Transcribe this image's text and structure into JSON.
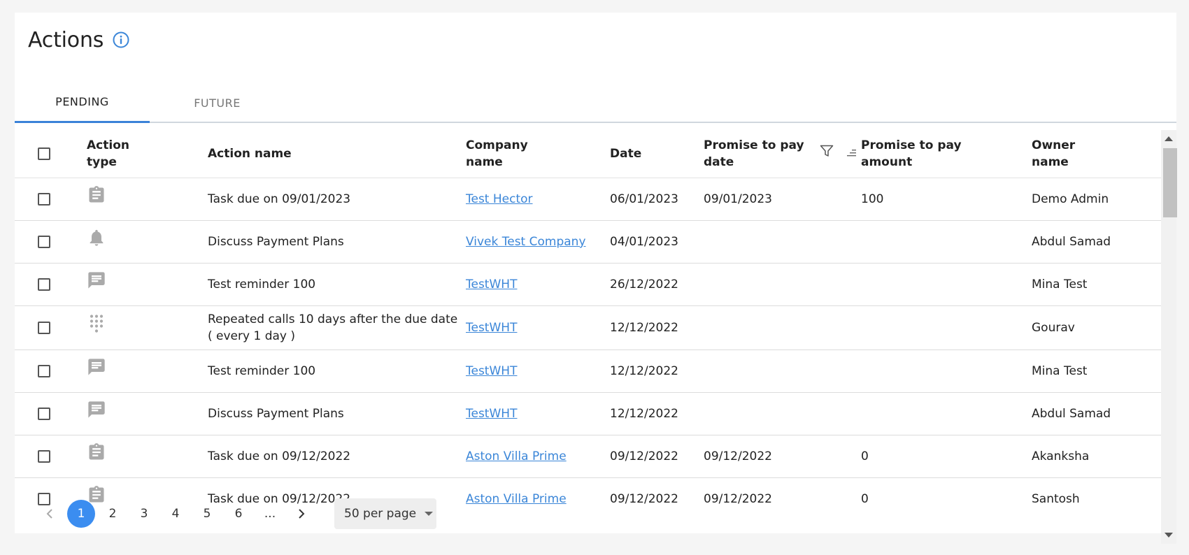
{
  "page": {
    "title": "Actions",
    "info_icon": "info-icon"
  },
  "tabs": [
    {
      "label": "PENDING",
      "active": true
    },
    {
      "label": "FUTURE",
      "active": false
    }
  ],
  "table": {
    "headers": {
      "action_type": [
        "Action",
        "type"
      ],
      "action_name": "Action name",
      "company_name": [
        "Company",
        "name"
      ],
      "date": "Date",
      "promise_date": [
        "Promise to pay",
        "date"
      ],
      "promise_amount": [
        "Promise to pay",
        "amount"
      ],
      "owner_name": [
        "Owner",
        "name"
      ]
    },
    "rows": [
      {
        "icon": "clipboard-icon",
        "action_name": "Task due on 09/01/2023",
        "company": "Test Hector",
        "date": "06/01/2023",
        "promise_date": "09/01/2023",
        "promise_amount": "100",
        "owner": "Demo Admin"
      },
      {
        "icon": "bell-icon",
        "action_name": "Discuss Payment Plans",
        "company": "Vivek Test Company",
        "date": "04/01/2023",
        "promise_date": "",
        "promise_amount": "",
        "owner": "Abdul Samad"
      },
      {
        "icon": "message-icon",
        "action_name": "Test reminder 100",
        "company": "TestWHT",
        "date": "26/12/2022",
        "promise_date": "",
        "promise_amount": "",
        "owner": "Mina Test"
      },
      {
        "icon": "dialpad-icon",
        "action_name": "Repeated calls 10 days after the due date",
        "action_name_2": "( every 1 day )",
        "company": "TestWHT",
        "date": "12/12/2022",
        "promise_date": "",
        "promise_amount": "",
        "owner": "Gourav"
      },
      {
        "icon": "message-icon",
        "action_name": "Test reminder 100",
        "company": "TestWHT",
        "date": "12/12/2022",
        "promise_date": "",
        "promise_amount": "",
        "owner": "Mina Test"
      },
      {
        "icon": "message-icon",
        "action_name": "Discuss Payment Plans",
        "company": "TestWHT",
        "date": "12/12/2022",
        "promise_date": "",
        "promise_amount": "",
        "owner": "Abdul Samad"
      },
      {
        "icon": "clipboard-icon",
        "action_name": "Task due on 09/12/2022",
        "company": "Aston Villa Prime",
        "date": "09/12/2022",
        "promise_date": "09/12/2022",
        "promise_amount": "0",
        "owner": "Akanksha"
      },
      {
        "icon": "clipboard-icon",
        "action_name": "Task due on 09/12/2022",
        "company": "Aston Villa Prime",
        "date": "09/12/2022",
        "promise_date": "09/12/2022",
        "promise_amount": "0",
        "owner": "Santosh"
      }
    ]
  },
  "pagination": {
    "pages": [
      "1",
      "2",
      "3",
      "4",
      "5",
      "6",
      "..."
    ],
    "current": "1",
    "per_page": "50 per page"
  },
  "colors": {
    "accent": "#3b82d8",
    "link": "#3b86d8",
    "active_page": "#3b8df0",
    "icon_gray": "#aaaaaa"
  }
}
